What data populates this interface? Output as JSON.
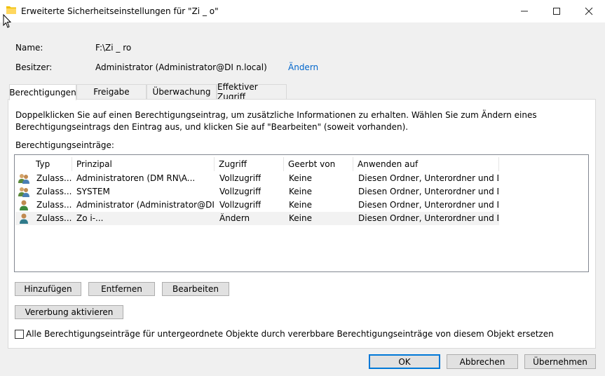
{
  "window": {
    "title": "Erweiterte Sicherheitseinstellungen für \"Zi      _       o\"",
    "icon": "folder-icon"
  },
  "info": {
    "name_label": "Name:",
    "name_value": "F:\\Zi        _      ro",
    "owner_label": "Besitzer:",
    "owner_value": "Administrator (Administrator@DI                 n.local)",
    "owner_change_link": "Ändern"
  },
  "tabs": [
    {
      "label": "Berechtigungen",
      "active": true
    },
    {
      "label": "Freigabe",
      "active": false
    },
    {
      "label": "Überwachung",
      "active": false
    },
    {
      "label": "Effektiver Zugriff",
      "active": false
    }
  ],
  "description": "Doppelklicken Sie auf einen Berechtigungseintrag, um zusätzliche Informationen zu erhalten. Wählen Sie zum Ändern eines Berechtigungseintrags den Eintrag aus, und klicken Sie auf \"Bearbeiten\" (soweit vorhanden).",
  "entries_label": "Berechtigungseinträge:",
  "columns": [
    "Typ",
    "Prinzipal",
    "Zugriff",
    "Geerbt von",
    "Anwenden auf"
  ],
  "rows": [
    {
      "icon": "user-group-icon",
      "typ": "Zulass...",
      "prinzipal": "Administratoren (DM               RN\\A...",
      "zugriff": "Vollzugriff",
      "geerbt": "Keine",
      "anwenden": "Diesen Ordner, Unterordner und Da..."
    },
    {
      "icon": "user-group-icon",
      "typ": "Zulass...",
      "prinzipal": "SYSTEM",
      "zugriff": "Vollzugriff",
      "geerbt": "Keine",
      "anwenden": "Diesen Ordner, Unterordner und Da..."
    },
    {
      "icon": "user-icon",
      "typ": "Zulass...",
      "prinzipal": "Administrator (Administrator@DI....",
      "zugriff": "Vollzugriff",
      "geerbt": "Keine",
      "anwenden": "Diesen Ordner, Unterordner und Da..."
    },
    {
      "icon": "user-icon",
      "typ": "Zulass...",
      "prinzipal": "Zo                                            i-...",
      "zugriff": "Ändern",
      "geerbt": "Keine",
      "anwenden": "Diesen Ordner, Unterordner und Da..."
    }
  ],
  "buttons": {
    "add": "Hinzufügen",
    "remove": "Entfernen",
    "edit": "Bearbeiten",
    "enable_inheritance": "Vererbung aktivieren",
    "ok": "OK",
    "cancel": "Abbrechen",
    "apply": "Übernehmen"
  },
  "replace_checkbox_label": "Alle Berechtigungseinträge für untergeordnete Objekte durch vererbbare Berechtigungseinträge von diesem Objekt ersetzen"
}
